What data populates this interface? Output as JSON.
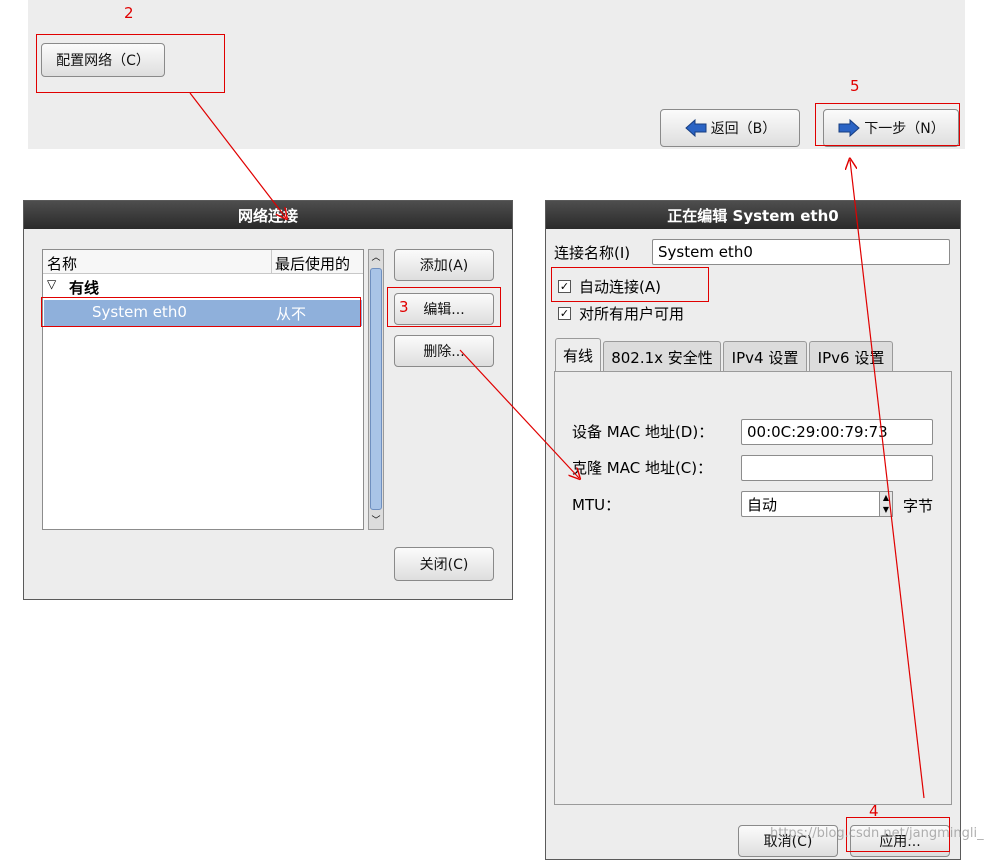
{
  "top_area": {
    "configure_network_button": "配置网络（C）",
    "back_button": "返回（B）",
    "next_button": "下一步（N）"
  },
  "network_connections": {
    "title": "网络连接",
    "columns": [
      "名称",
      "最后使用的"
    ],
    "group": "有线",
    "row": {
      "name": "System eth0",
      "last_used": "从不"
    },
    "add_button": "添加(A)",
    "edit_button": "编辑...",
    "delete_button": "删除...",
    "close_button": "关闭(C)"
  },
  "editing_dialog": {
    "title": "正在编辑 System eth0",
    "connection_name_label": "连接名称(I)",
    "connection_name_value": "System eth0",
    "auto_connect_label": "自动连接(A)",
    "all_users_label": "对所有用户可用",
    "tabs": [
      "有线",
      "802.1x 安全性",
      "IPv4 设置",
      "IPv6 设置"
    ],
    "device_mac_label": "设备 MAC 地址(D)：",
    "device_mac_value": "00:0C:29:00:79:73",
    "cloned_mac_label": "克隆 MAC 地址(C)：",
    "cloned_mac_value": "",
    "mtu_label": "MTU：",
    "mtu_value": "自动",
    "mtu_unit": "字节",
    "cancel_button": "取消(C)",
    "apply_button": "应用..."
  },
  "annotations": [
    "2",
    "3",
    "4",
    "5"
  ],
  "watermark": "https://blog.csdn.net/jangmingli_",
  "colors": {
    "annotation": "#e00000",
    "selection": "#8fb0db",
    "titlebar": "#333333"
  }
}
